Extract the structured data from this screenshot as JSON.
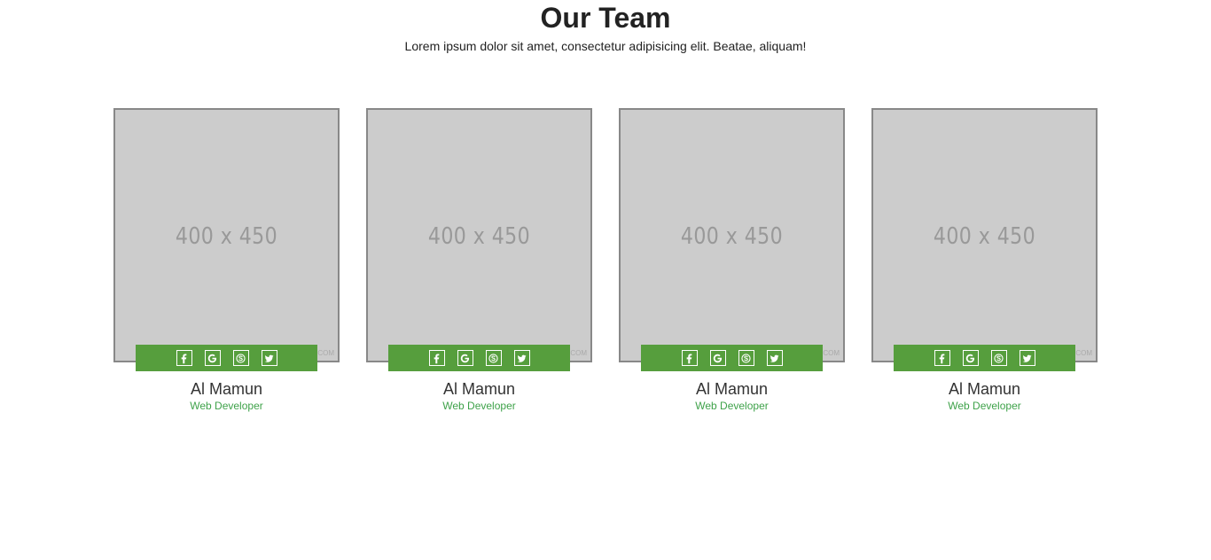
{
  "header": {
    "title": "Our Team",
    "subtitle": "Lorem ipsum dolor sit amet, consectetur adipisicing elit. Beatae, aliquam!"
  },
  "colors": {
    "accent_green": "#569e3d",
    "role_green": "#3fa24a",
    "placeholder_gray": "#cccccc"
  },
  "members": [
    {
      "photo_placeholder": "400 x 450",
      "watermark": "COM",
      "name": "Al Mamun",
      "role": "Web Developer",
      "social": [
        "facebook-icon",
        "google-icon",
        "skype-icon",
        "twitter-icon"
      ]
    },
    {
      "photo_placeholder": "400 x 450",
      "watermark": "COM",
      "name": "Al Mamun",
      "role": "Web Developer",
      "social": [
        "facebook-icon",
        "google-icon",
        "skype-icon",
        "twitter-icon"
      ]
    },
    {
      "photo_placeholder": "400 x 450",
      "watermark": "COM",
      "name": "Al Mamun",
      "role": "Web Developer",
      "social": [
        "facebook-icon",
        "google-icon",
        "skype-icon",
        "twitter-icon"
      ]
    },
    {
      "photo_placeholder": "400 x 450",
      "watermark": "COM",
      "name": "Al Mamun",
      "role": "Web Developer",
      "social": [
        "facebook-icon",
        "google-icon",
        "skype-icon",
        "twitter-icon"
      ]
    }
  ]
}
